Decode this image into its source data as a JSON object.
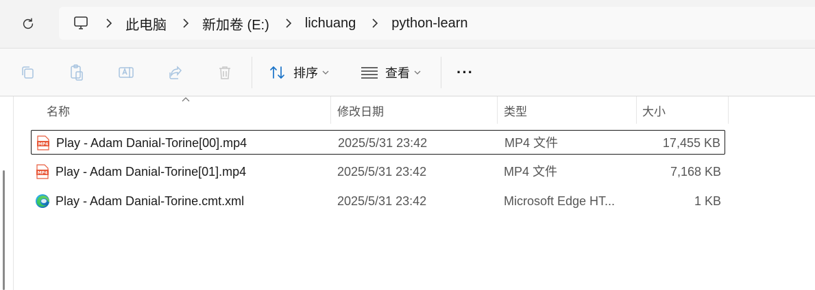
{
  "breadcrumb": {
    "items": [
      "此电脑",
      "新加卷 (E:)",
      "lichuang",
      "python-learn"
    ]
  },
  "toolbar": {
    "sort_label": "排序",
    "view_label": "查看",
    "more_label": "···"
  },
  "columns": {
    "name": "名称",
    "date": "修改日期",
    "type": "类型",
    "size": "大小"
  },
  "files": [
    {
      "name": "Play - Adam Danial-Torine[00].mp4",
      "date": "2025/5/31 23:42",
      "type": "MP4 文件",
      "size": "17,455 KB",
      "icon": "mp4-file-icon",
      "selected": true
    },
    {
      "name": "Play - Adam Danial-Torine[01].mp4",
      "date": "2025/5/31 23:42",
      "type": "MP4 文件",
      "size": "7,168 KB",
      "icon": "mp4-file-icon",
      "selected": false
    },
    {
      "name": "Play - Adam Danial-Torine.cmt.xml",
      "date": "2025/5/31 23:42",
      "type": "Microsoft Edge HT...",
      "size": "1 KB",
      "icon": "edge-icon",
      "selected": false
    }
  ],
  "colors": {
    "accent": "#1a73c8",
    "mp4_icon": "#e8593a",
    "disabled_icon": "#a8c4e0"
  }
}
